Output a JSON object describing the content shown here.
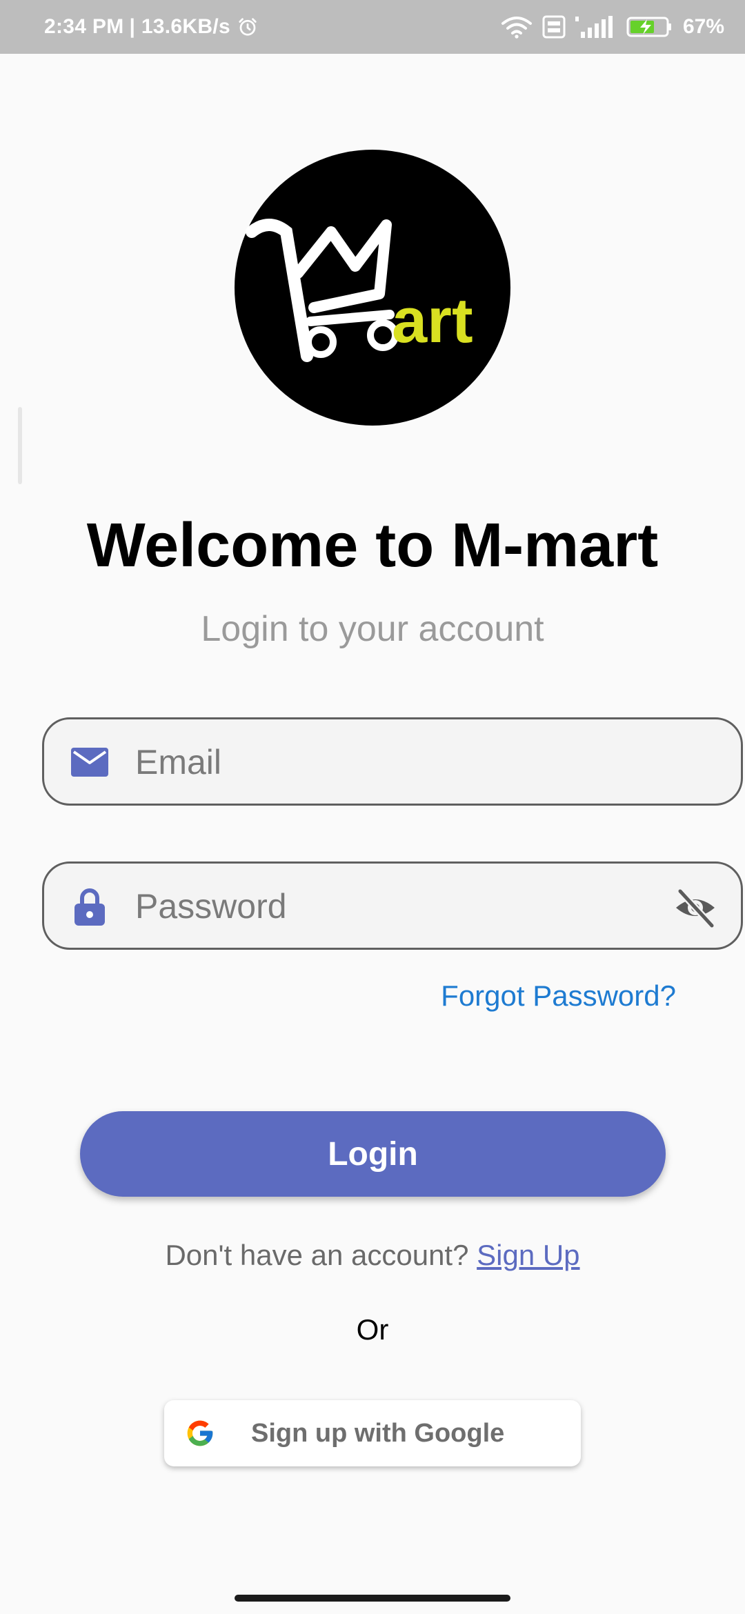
{
  "status_bar": {
    "time": "2:34 PM",
    "network_speed": "| 13.6KB/s",
    "battery": "67%"
  },
  "logo": {
    "text": "Mart",
    "colors": {
      "background": "#000000",
      "cart": "#ffffff",
      "letters": "#d9e021"
    }
  },
  "header": {
    "title": "Welcome to M-mart",
    "subtitle": "Login to your account"
  },
  "form": {
    "email": {
      "placeholder": "Email",
      "icon": "mail-icon"
    },
    "password": {
      "placeholder": "Password",
      "icon": "lock-icon",
      "toggle_icon": "eye-off-icon"
    },
    "forgot_label": "Forgot Password?",
    "login_label": "Login"
  },
  "signup": {
    "prompt": "Don't have an account?",
    "link": "Sign Up"
  },
  "divider_text": "Or",
  "google": {
    "label": "Sign up with Google",
    "icon": "google-icon"
  },
  "colors": {
    "accent": "#5c6bc0",
    "link": "#1e7bd1",
    "status_bar": "#bdbdbd"
  }
}
